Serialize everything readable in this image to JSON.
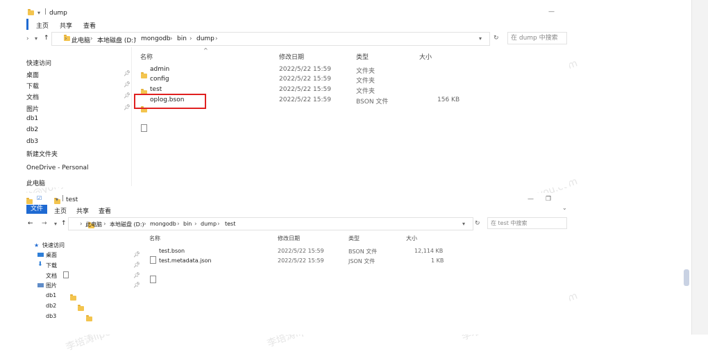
{
  "win1": {
    "title": "dump",
    "ribbon_tabs": [
      "主页",
      "共享",
      "查看"
    ],
    "breadcrumb": [
      "此电脑",
      "本地磁盘 (D:)",
      "mongodb",
      "bin",
      "dump"
    ],
    "search_placeholder": "在 dump 中搜索",
    "columns": {
      "name": "名称",
      "date": "修改日期",
      "type": "类型",
      "size": "大小"
    },
    "sidebar": [
      "快速访问",
      "桌面",
      "下载",
      "文档",
      "图片",
      "db1",
      "db2",
      "db3",
      "新建文件夹",
      "OneDrive - Personal",
      "此电脑"
    ],
    "files": [
      {
        "name": "admin",
        "date": "2022/5/22 15:59",
        "type": "文件夹",
        "size": ""
      },
      {
        "name": "config",
        "date": "2022/5/22 15:59",
        "type": "文件夹",
        "size": ""
      },
      {
        "name": "test",
        "date": "2022/5/22 15:59",
        "type": "文件夹",
        "size": ""
      },
      {
        "name": "oplog.bson",
        "date": "2022/5/22 15:59",
        "type": "BSON 文件",
        "size": "156 KB"
      }
    ]
  },
  "win2": {
    "title": "test",
    "ribbon_tabs": [
      "文件",
      "主页",
      "共享",
      "查看"
    ],
    "breadcrumb": [
      "此电脑",
      "本地磁盘 (D:)",
      "mongodb",
      "bin",
      "dump",
      "test"
    ],
    "search_placeholder": "在 test 中搜索",
    "columns": {
      "name": "名称",
      "date": "修改日期",
      "type": "类型",
      "size": "大小"
    },
    "sidebar": [
      "快速访问",
      "桌面",
      "下载",
      "文档",
      "图片",
      "db1",
      "db2",
      "db3"
    ],
    "files": [
      {
        "name": "test.bson",
        "date": "2022/5/22 15:59",
        "type": "BSON 文件",
        "size": "12,114 KB"
      },
      {
        "name": "test.metadata.json",
        "date": "2022/5/22 15:59",
        "type": "JSON 文件",
        "size": "1 KB"
      }
    ]
  },
  "watermark": "李培涛lipeit@yonyou.com"
}
